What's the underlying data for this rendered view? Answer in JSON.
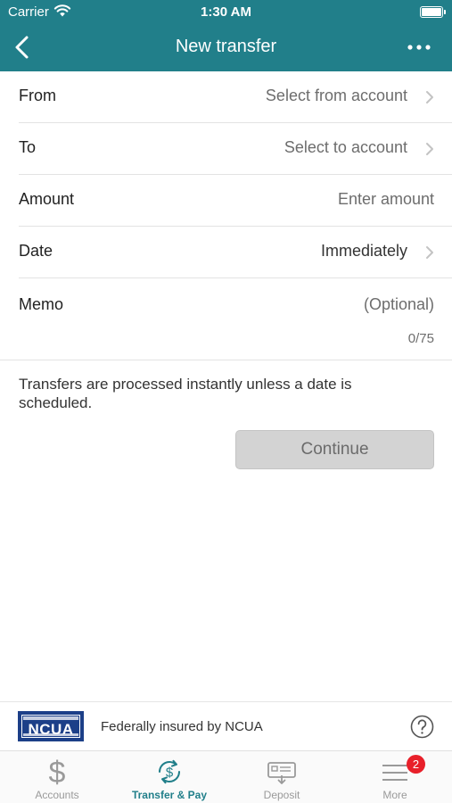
{
  "status_bar": {
    "carrier": "Carrier",
    "time": "1:30 AM"
  },
  "nav": {
    "title": "New transfer"
  },
  "form": {
    "from": {
      "label": "From",
      "value": "Select from account"
    },
    "to": {
      "label": "To",
      "value": "Select to account"
    },
    "amount": {
      "label": "Amount",
      "placeholder": "Enter amount"
    },
    "date": {
      "label": "Date",
      "value": "Immediately"
    },
    "memo": {
      "label": "Memo",
      "placeholder": "(Optional)",
      "counter": "0/75"
    }
  },
  "info_text": "Transfers are processed instantly unless a date is scheduled.",
  "continue_label": "Continue",
  "insurance": {
    "logo_text": "NCUA",
    "text": "Federally insured by NCUA"
  },
  "tabs": [
    {
      "label": "Accounts",
      "icon": "dollar-icon"
    },
    {
      "label": "Transfer & Pay",
      "icon": "transfer-pay-icon"
    },
    {
      "label": "Deposit",
      "icon": "check-deposit-icon"
    },
    {
      "label": "More",
      "icon": "menu-icon",
      "badge": "2"
    }
  ],
  "colors": {
    "brand": "#217f8a",
    "badge": "#e8202a",
    "button_disabled": "#d3d3d3"
  }
}
